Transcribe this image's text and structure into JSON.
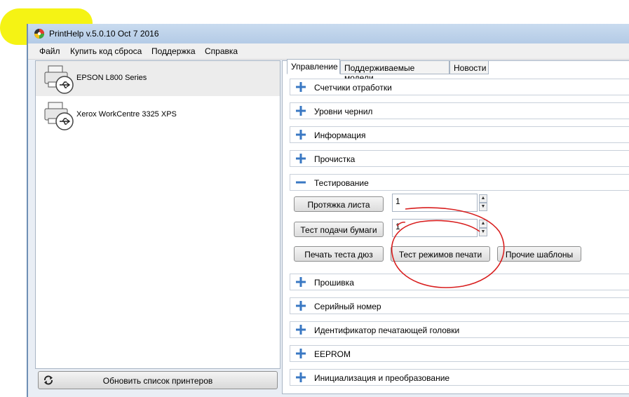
{
  "window": {
    "title": "PrintHelp v.5.0.10 Oct  7 2016"
  },
  "menu": [
    {
      "label": "Файл"
    },
    {
      "label": "Купить код сброса"
    },
    {
      "label": "Поддержка"
    },
    {
      "label": "Справка"
    }
  ],
  "printers": [
    {
      "name": "EPSON L800 Series",
      "selected": true
    },
    {
      "name": "Xerox WorkCentre 3325 XPS",
      "selected": false
    }
  ],
  "refresh_button": {
    "label": "Обновить список принтеров"
  },
  "tabs": [
    {
      "label": "Управление",
      "active": true
    },
    {
      "label": "Поддерживаемые модели",
      "active": false
    },
    {
      "label": "Новости",
      "active": false
    }
  ],
  "sections_top": [
    {
      "label": "Счетчики отработки"
    },
    {
      "label": "Уровни чернил"
    },
    {
      "label": "Информация"
    },
    {
      "label": "Прочистка"
    }
  ],
  "testing": {
    "label": "Тестирование",
    "feed_button": "Протяжка листа",
    "feed_value": "1",
    "paper_button": "Тест подачи бумаги",
    "paper_value": "1",
    "nozzle_button": "Печать теста дюз",
    "modes_button": "Тест режимов печати",
    "templates_button": "Прочие шаблоны"
  },
  "sections_bottom": [
    {
      "label": "Прошивка"
    },
    {
      "label": "Серийный номер"
    },
    {
      "label": "Идентификатор печатающей головки"
    },
    {
      "label": "EEPROM"
    },
    {
      "label": "Инициализация и преобразование"
    }
  ],
  "colors": {
    "highlight": "#f4f200",
    "annotation": "#d81e1e",
    "plus_icon": "#3a78c3"
  }
}
